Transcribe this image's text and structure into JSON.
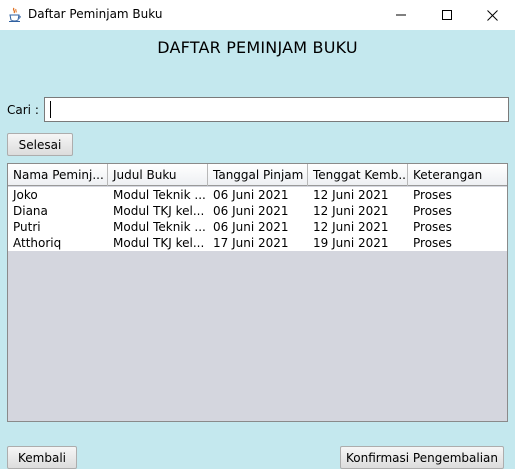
{
  "window": {
    "title": "Daftar Peminjam Buku",
    "icon": "java-cup-icon",
    "controls": [
      "minimize-icon",
      "maximize-icon",
      "close-icon"
    ]
  },
  "main": {
    "heading": "DAFTAR PEMINJAM BUKU",
    "search": {
      "label": "Cari :",
      "value": "",
      "placeholder": ""
    },
    "finish_button": "Selesai",
    "table": {
      "columns": [
        "Nama Peminj...",
        "Judul Buku",
        "Tanggal Pinjam",
        "Tenggat Kemb...",
        "Keterangan"
      ],
      "rows": [
        [
          "Joko",
          "Modul Teknik ...",
          "06 Juni 2021",
          "12 Juni 2021",
          "Proses"
        ],
        [
          "Diana",
          "Modul TKJ kel...",
          "06 Juni 2021",
          "12 Juni 2021",
          "Proses"
        ],
        [
          "Putri",
          "Modul Teknik ...",
          "06 Juni 2021",
          "12 Juni 2021",
          "Proses"
        ],
        [
          "Atthoriq",
          "Modul TKJ kel...",
          "17 Juni 2021",
          "19 Juni 2021",
          "Proses"
        ]
      ]
    }
  },
  "footer": {
    "back_button": "Kembali",
    "confirm_button": "Konfirmasi Pengembalian"
  },
  "colors": {
    "background": "#c4e8ee",
    "table_empty": "#d4d6de",
    "titlebar": "#ffffff"
  }
}
